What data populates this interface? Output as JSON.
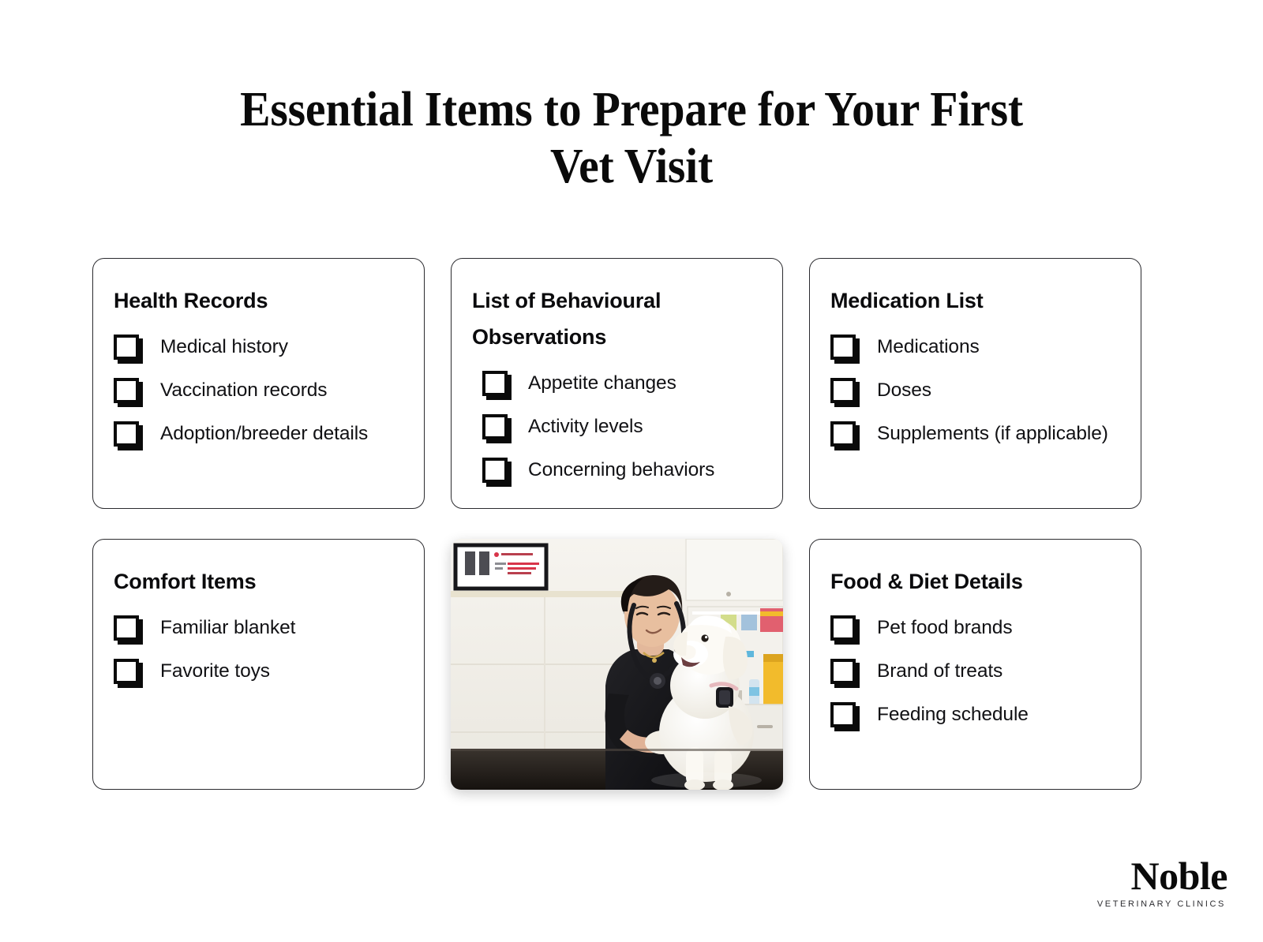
{
  "page": {
    "title": "Essential Items to Prepare for Your First Vet Visit",
    "title_line_1": "Essential Items to Prepare for Your First",
    "title_line_2": "Vet Visit",
    "background_color": "#ffffff",
    "text_color": "#0a0a0a",
    "accent_color": "#0a0a0a"
  },
  "cards": [
    {
      "id": "health-records",
      "title": "Health Records",
      "items": [
        {
          "label": "Medical history",
          "checked": false
        },
        {
          "label": "Vaccination records",
          "checked": false
        },
        {
          "label": "Adoption/breeder details",
          "checked": false
        }
      ]
    },
    {
      "id": "behavioural-observations",
      "title": "List of Behavioural Observations",
      "title_line_1": "List of Behavioural",
      "title_line_2": "Observations",
      "items": [
        {
          "label": "Appetite changes",
          "checked": false
        },
        {
          "label": "Activity levels",
          "checked": false
        },
        {
          "label": "Concerning behaviors",
          "checked": false
        }
      ]
    },
    {
      "id": "medication-list",
      "title": "Medication List",
      "items": [
        {
          "label": "Medications",
          "checked": false
        },
        {
          "label": "Doses",
          "checked": false
        },
        {
          "label": "Supplements (if applicable)",
          "checked": false
        }
      ]
    },
    {
      "id": "comfort-items",
      "title": "Comfort Items",
      "items": [
        {
          "label": "Familiar blanket",
          "checked": false
        },
        {
          "label": "Favorite toys",
          "checked": false
        }
      ]
    },
    {
      "id": "food-diet-details",
      "title": "Food & Diet Details",
      "items": [
        {
          "label": "Pet food brands",
          "checked": false
        },
        {
          "label": "Brand of treats",
          "checked": false
        },
        {
          "label": "Feeding schedule",
          "checked": false
        }
      ]
    }
  ],
  "photo": {
    "alt": "Veterinarian in black scrubs with a stethoscope examining a small white fluffy dog on a clinic exam table",
    "colors": {
      "wall": "#efede6",
      "tile": "#f4f2ec",
      "scrubs": "#17171a",
      "dog": "#fbfaf6",
      "counter": "#2a2724",
      "cabinet": "#f7f6f2",
      "skin": "#e2b79a",
      "hair": "#241c18",
      "yellow_box": "#f2bb2c",
      "poster_red": "#d8354a"
    }
  },
  "logo": {
    "word": "Noble",
    "tagline": "VETERINARY CLINICS"
  }
}
